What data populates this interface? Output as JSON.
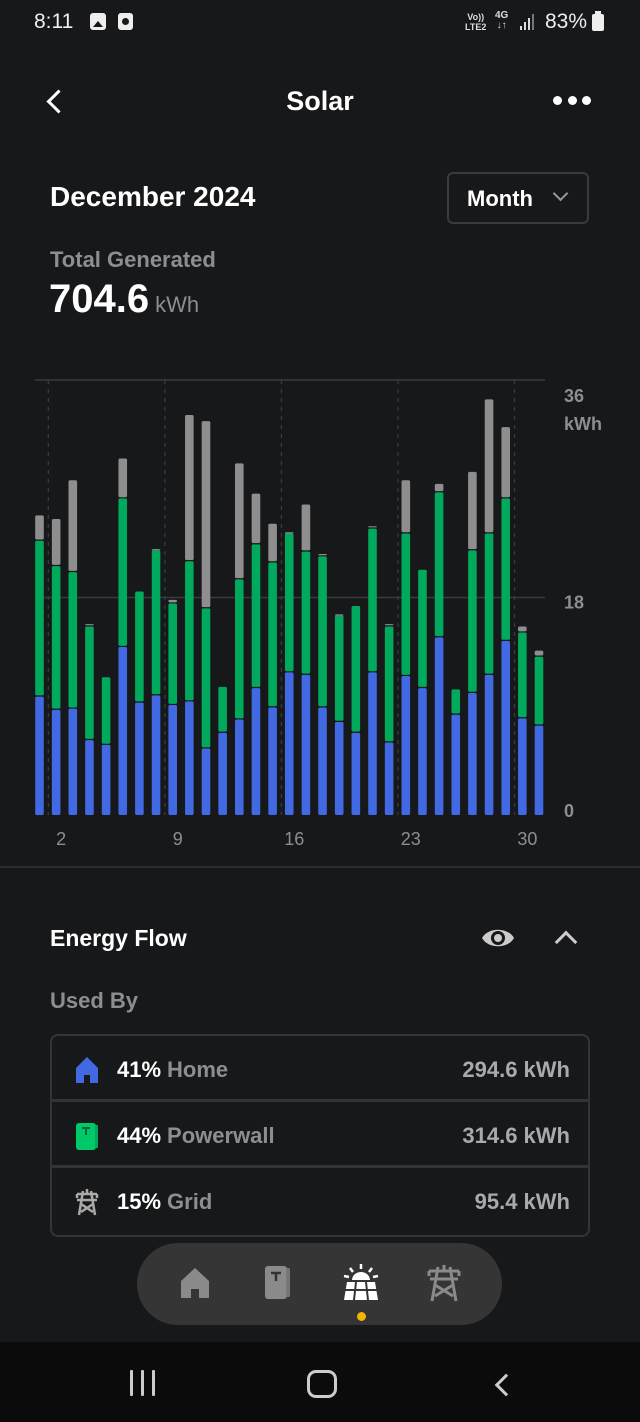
{
  "status_bar": {
    "time": "8:11",
    "notification_icons": [
      "gallery-icon",
      "clock-app-icon"
    ],
    "volte_label": "Vo)) LTE2",
    "network_label": "4G",
    "battery_percent": "83%"
  },
  "header": {
    "title": "Solar",
    "back_icon": "chevron-left-icon",
    "more_icon": "more-horizontal-icon"
  },
  "period": {
    "label": "December 2024",
    "range_select": "Month"
  },
  "summary": {
    "label": "Total Generated",
    "value": "704.6",
    "unit": "kWh"
  },
  "colors": {
    "home": "#4169e1",
    "powerwall": "#00a95c",
    "grid": "#8e8e8e",
    "accent_dot": "#f4b400"
  },
  "chart_data": {
    "type": "bar",
    "stacked": true,
    "title": "",
    "xlabel": "",
    "ylabel": "kWh",
    "ylim": [
      0,
      36
    ],
    "yticks": [
      "0",
      "18",
      "36"
    ],
    "y_unit_label": "kWh",
    "grid": true,
    "x": [
      1,
      2,
      3,
      4,
      5,
      6,
      7,
      8,
      9,
      10,
      11,
      12,
      13,
      14,
      15,
      16,
      17,
      18,
      19,
      20,
      21,
      22,
      23,
      24,
      25,
      26,
      27,
      28,
      29,
      30,
      31
    ],
    "xtick_labels": [
      {
        "day": 2,
        "label": "2"
      },
      {
        "day": 9,
        "label": "9"
      },
      {
        "day": 16,
        "label": "16"
      },
      {
        "day": 23,
        "label": "23"
      },
      {
        "day": 30,
        "label": "30"
      }
    ],
    "series": [
      {
        "name": "Home",
        "color": "#4169e1",
        "values": [
          9.8,
          8.7,
          8.8,
          6.2,
          5.8,
          13.9,
          9.3,
          9.9,
          9.1,
          9.4,
          5.5,
          6.8,
          7.9,
          10.5,
          8.9,
          11.8,
          11.6,
          8.9,
          7.7,
          6.8,
          11.8,
          6.0,
          11.5,
          10.5,
          14.7,
          8.3,
          10.1,
          11.6,
          14.4,
          8.0,
          7.4
        ]
      },
      {
        "name": "Powerwall",
        "color": "#00a95c",
        "values": [
          12.9,
          11.9,
          11.3,
          9.4,
          5.6,
          12.3,
          9.2,
          12.0,
          8.4,
          11.6,
          11.6,
          3.8,
          11.6,
          11.9,
          12.0,
          11.5,
          10.2,
          12.5,
          8.8,
          10.5,
          11.9,
          9.6,
          11.8,
          9.8,
          12.0,
          2.1,
          11.8,
          11.7,
          11.8,
          7.1,
          5.7
        ]
      },
      {
        "name": "Grid",
        "color": "#8e8e8e",
        "values": [
          2.1,
          3.9,
          7.6,
          0.2,
          0,
          3.3,
          0,
          0.1,
          0.3,
          12.1,
          15.5,
          0,
          9.6,
          4.2,
          3.2,
          0.1,
          3.9,
          0.2,
          0.1,
          0,
          0.2,
          0.2,
          4.4,
          0,
          0.7,
          0,
          6.5,
          11.1,
          5.9,
          0.5,
          0.5
        ]
      }
    ]
  },
  "energy_flow": {
    "title": "Energy Flow",
    "visibility_icon": "eye-icon",
    "collapse_icon": "chevron-up-icon",
    "subtitle": "Used By",
    "rows": [
      {
        "icon": "home-icon",
        "percent": "41%",
        "name": "Home",
        "amount": "294.6 kWh"
      },
      {
        "icon": "powerwall-icon",
        "percent": "44%",
        "name": "Powerwall",
        "amount": "314.6 kWh"
      },
      {
        "icon": "grid-tower-icon",
        "percent": "15%",
        "name": "Grid",
        "amount": "95.4 kWh"
      }
    ]
  },
  "bottom_nav": {
    "items": [
      {
        "icon": "home-icon",
        "active": false
      },
      {
        "icon": "powerwall-icon",
        "active": false
      },
      {
        "icon": "solar-icon",
        "active": true
      },
      {
        "icon": "grid-tower-icon",
        "active": false
      }
    ]
  },
  "system_nav": [
    "recents-icon",
    "home-circle-icon",
    "back-icon"
  ]
}
